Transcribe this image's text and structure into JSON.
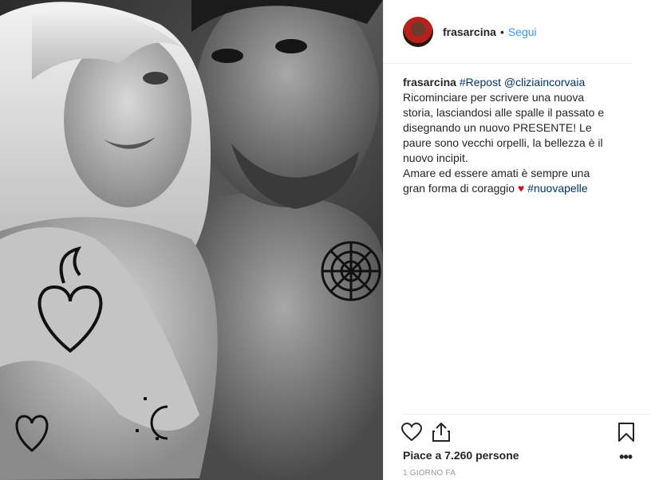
{
  "header": {
    "username": "frasarcina",
    "separator": "•",
    "follow_label": "Segui"
  },
  "caption": {
    "username": "frasarcina",
    "hashtag_repost": "#Repost",
    "mention": "@cliziaincorvaia",
    "line1": "Ricominciare per scrivere una nuova storia, lasciandosi alle spalle il passato e disegnando un nuovo PRESENTE! Le paure sono vecchi orpelli, la bellezza è il nuovo incipit.",
    "line2": "Amare ed essere amati è sempre una gran forma di coraggio",
    "heart": "♥",
    "hashtag_end": "#nuovapelle"
  },
  "actions": {
    "like_icon": "heart-outline-icon",
    "share_icon": "share-icon",
    "save_icon": "bookmark-icon"
  },
  "likes": {
    "text": "Piace a 7.260 persone"
  },
  "more_label": "•••",
  "timestamp": "1 GIORNO FA",
  "colors": {
    "link_blue": "#3897f0",
    "tag_blue": "#003569",
    "heart_red": "#c8102e",
    "muted": "#999999"
  }
}
